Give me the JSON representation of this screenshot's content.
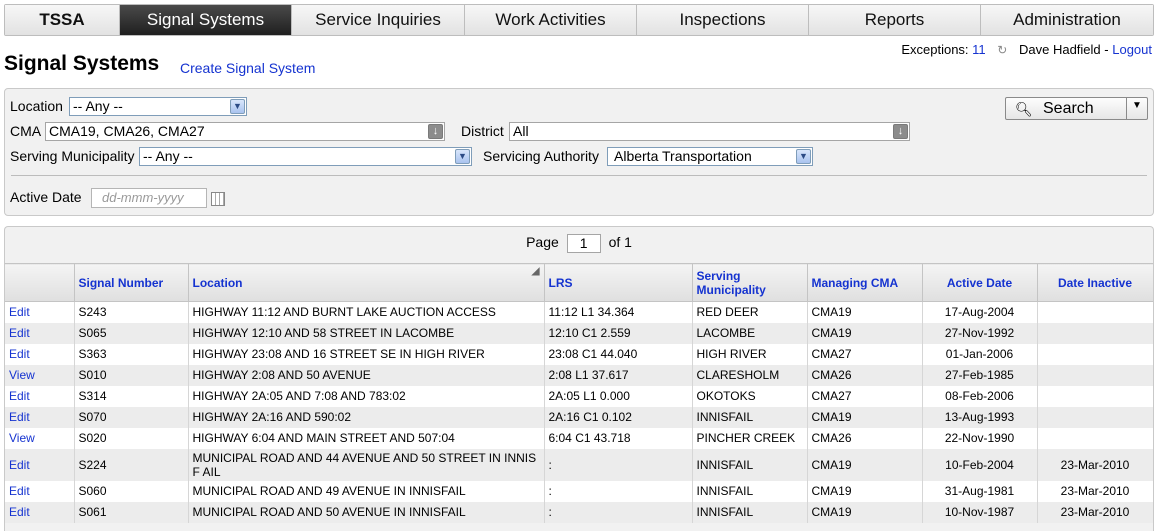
{
  "nav": {
    "tabs": [
      "TSSA",
      "Signal Systems",
      "Service Inquiries",
      "Work Activities",
      "Inspections",
      "Reports",
      "Administration"
    ],
    "active": "Signal Systems"
  },
  "status": {
    "exceptions_label": "Exceptions:",
    "exceptions_count": "11",
    "user": "Dave Hadfield",
    "separator": "-",
    "logout": "Logout"
  },
  "page": {
    "title": "Signal Systems",
    "create_link": "Create Signal System"
  },
  "filters": {
    "location_label": "Location",
    "location_value": "-- Any --",
    "cma_label": "CMA",
    "cma_value": "CMA19, CMA26, CMA27",
    "district_label": "District",
    "district_value": "All",
    "municipality_label": "Serving Municipality",
    "municipality_value": "-- Any --",
    "authority_label": "Servicing Authority",
    "authority_value": "Alberta Transportation",
    "active_date_label": "Active Date",
    "active_date_placeholder": "dd-mmm-yyyy",
    "search_label": "Search"
  },
  "pager": {
    "page_label": "Page",
    "page_value": "1",
    "of_label": "of 1"
  },
  "table": {
    "columns": [
      "",
      "Signal Number",
      "Location",
      "LRS",
      "Serving Municipality",
      "Managing CMA",
      "Active Date",
      "Date Inactive"
    ],
    "rows": [
      {
        "action": "Edit",
        "signal": "S243",
        "location": "HIGHWAY 11:12 AND BURNT LAKE AUCTION ACCESS",
        "lrs": "11:12 L1 34.364",
        "municipality": "RED DEER",
        "cma": "CMA19",
        "active": "17-Aug-2004",
        "inactive": ""
      },
      {
        "action": "Edit",
        "signal": "S065",
        "location": "HIGHWAY 12:10 AND 58 STREET IN LACOMBE",
        "lrs": "12:10 C1 2.559",
        "municipality": "LACOMBE",
        "cma": "CMA19",
        "active": "27-Nov-1992",
        "inactive": ""
      },
      {
        "action": "Edit",
        "signal": "S363",
        "location": "HIGHWAY 23:08 AND 16 STREET SE IN HIGH RIVER",
        "lrs": "23:08 C1 44.040",
        "municipality": "HIGH RIVER",
        "cma": "CMA27",
        "active": "01-Jan-2006",
        "inactive": ""
      },
      {
        "action": "View",
        "signal": "S010",
        "location": "HIGHWAY 2:08 AND 50 AVENUE",
        "lrs": "2:08 L1 37.617",
        "municipality": "CLARESHOLM",
        "cma": "CMA26",
        "active": "27-Feb-1985",
        "inactive": ""
      },
      {
        "action": "Edit",
        "signal": "S314",
        "location": "HIGHWAY 2A:05 AND 7:08 AND 783:02",
        "lrs": "2A:05 L1 0.000",
        "municipality": "OKOTOKS",
        "cma": "CMA27",
        "active": "08-Feb-2006",
        "inactive": ""
      },
      {
        "action": "Edit",
        "signal": "S070",
        "location": "HIGHWAY 2A:16 AND 590:02",
        "lrs": "2A:16 C1 0.102",
        "municipality": "INNISFAIL",
        "cma": "CMA19",
        "active": "13-Aug-1993",
        "inactive": ""
      },
      {
        "action": "View",
        "signal": "S020",
        "location": "HIGHWAY 6:04 AND MAIN STREET AND 507:04",
        "lrs": "6:04 C1 43.718",
        "municipality": "PINCHER CREEK",
        "cma": "CMA26",
        "active": "22-Nov-1990",
        "inactive": ""
      },
      {
        "action": "Edit",
        "signal": "S224",
        "location": "MUNICIPAL ROAD AND 44 AVENUE AND 50 STREET IN INNISF AIL",
        "lrs": ":",
        "municipality": "INNISFAIL",
        "cma": "CMA19",
        "active": "10-Feb-2004",
        "inactive": "23-Mar-2010"
      },
      {
        "action": "Edit",
        "signal": "S060",
        "location": "MUNICIPAL ROAD AND 49 AVENUE IN INNISFAIL",
        "lrs": ":",
        "municipality": "INNISFAIL",
        "cma": "CMA19",
        "active": "31-Aug-1981",
        "inactive": "23-Mar-2010"
      },
      {
        "action": "Edit",
        "signal": "S061",
        "location": "MUNICIPAL ROAD AND 50 AVENUE IN INNISFAIL",
        "lrs": ":",
        "municipality": "INNISFAIL",
        "cma": "CMA19",
        "active": "10-Nov-1987",
        "inactive": "23-Mar-2010"
      }
    ]
  }
}
